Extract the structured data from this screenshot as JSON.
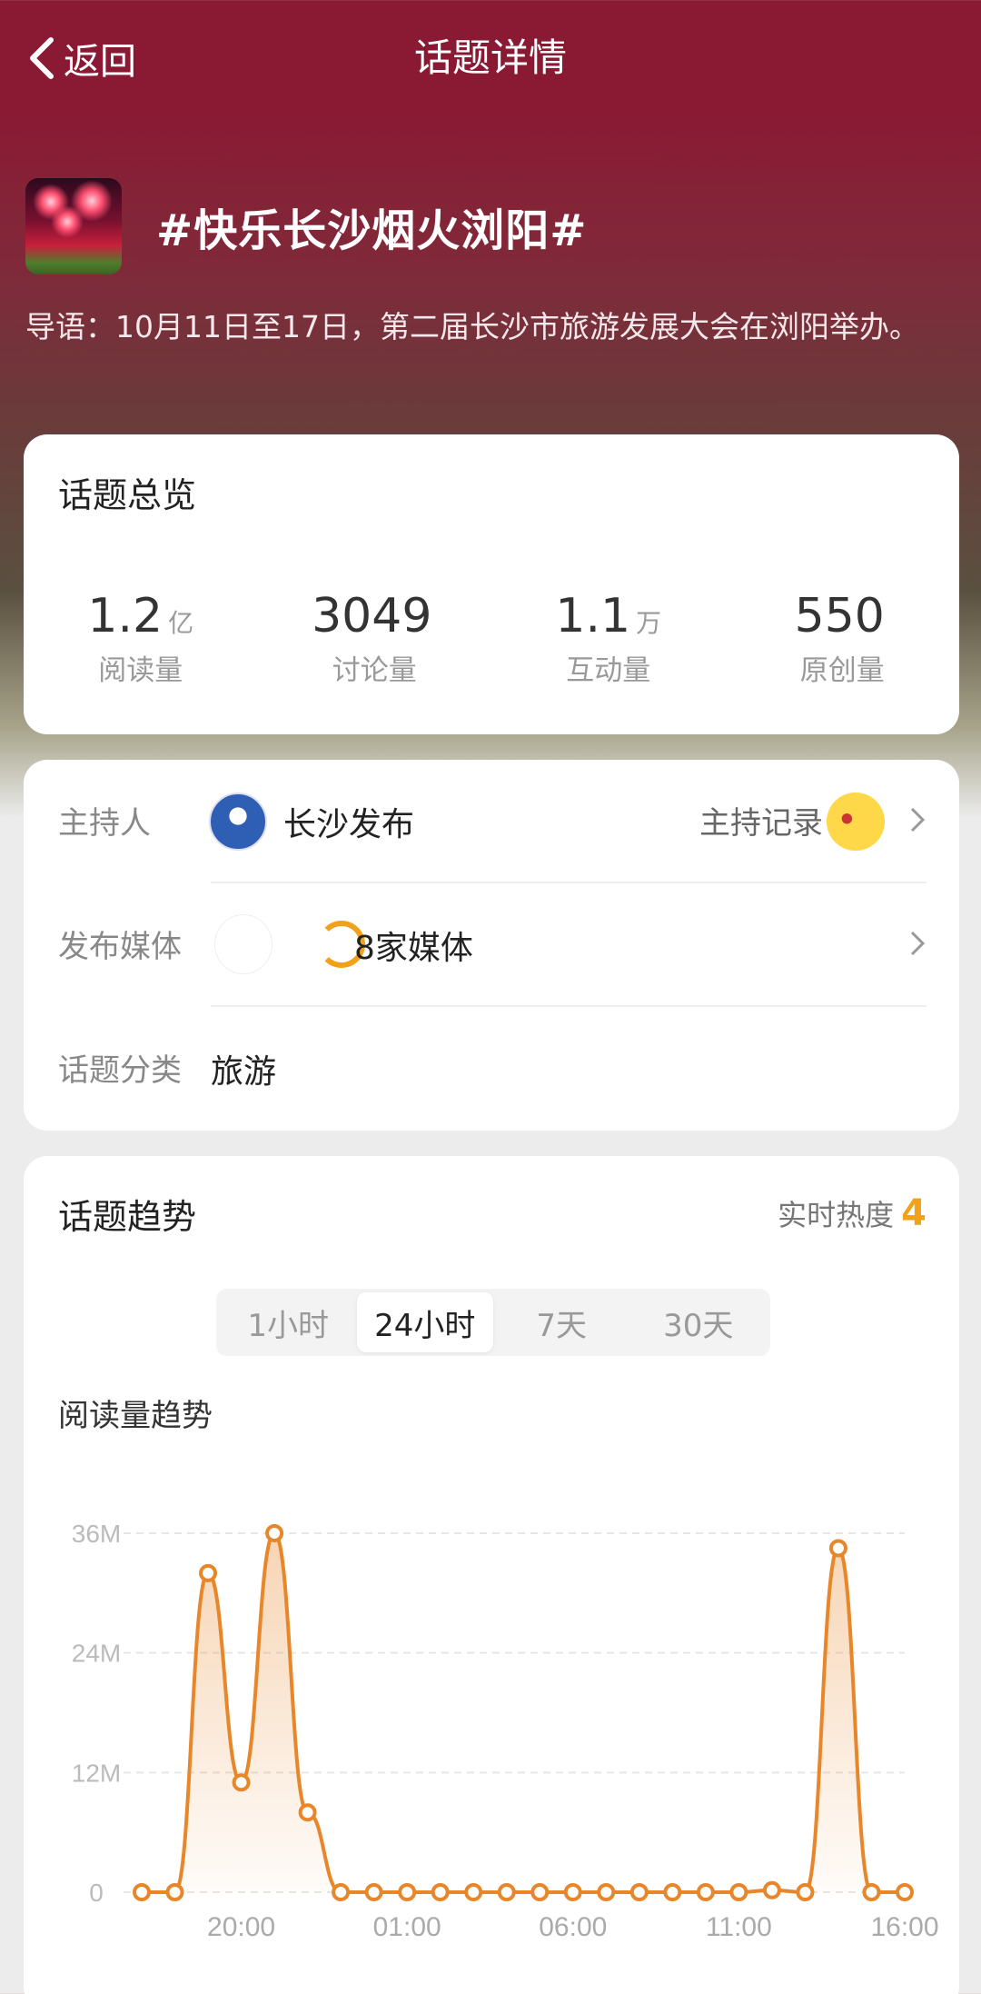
{
  "header": {
    "back_label": "返回",
    "title": "话题详情"
  },
  "topic": {
    "name": "#快乐长沙烟火浏阳#",
    "intro": "导语：10月11日至17日，第二届长沙市旅游发展大会在浏阳举办。"
  },
  "overview": {
    "title": "话题总览",
    "stats": [
      {
        "value": "1.2",
        "unit": "亿",
        "label": "阅读量"
      },
      {
        "value": "3049",
        "unit": "",
        "label": "讨论量"
      },
      {
        "value": "1.1",
        "unit": "万",
        "label": "互动量"
      },
      {
        "value": "550",
        "unit": "",
        "label": "原创量"
      }
    ]
  },
  "info": {
    "host_label": "主持人",
    "host_name": "长沙发布",
    "host_record_label": "主持记录",
    "media_label": "发布媒体",
    "media_count": "8家媒体",
    "category_label": "话题分类",
    "category_value": "旅游"
  },
  "trend": {
    "title": "话题趋势",
    "heat_label": "实时热度",
    "heat_value": "4",
    "tabs": [
      "1小时",
      "24小时",
      "7天",
      "30天"
    ],
    "active_tab": 1,
    "chart_title": "阅读量趋势"
  },
  "colors": {
    "accent": "#e8862a",
    "heat": "#f0a21b"
  },
  "chart_data": {
    "type": "area",
    "title": "阅读量趋势",
    "unit": "M",
    "y_ticks": [
      "0",
      "12M",
      "24M",
      "36M"
    ],
    "y_tick_values": [
      0,
      12,
      24,
      36
    ],
    "ylim": [
      0,
      36
    ],
    "x_tick_labels": [
      "20:00",
      "01:00",
      "06:00",
      "11:00",
      "16:00"
    ],
    "x_tick_indices": [
      3,
      8,
      13,
      18,
      23
    ],
    "values": [
      0,
      0,
      32,
      11,
      36,
      8,
      0,
      0,
      0,
      0,
      0,
      0,
      0,
      0,
      0,
      0,
      0,
      0,
      0,
      0.2,
      0,
      34.5,
      0,
      0
    ],
    "grid": true,
    "legend": "none"
  }
}
